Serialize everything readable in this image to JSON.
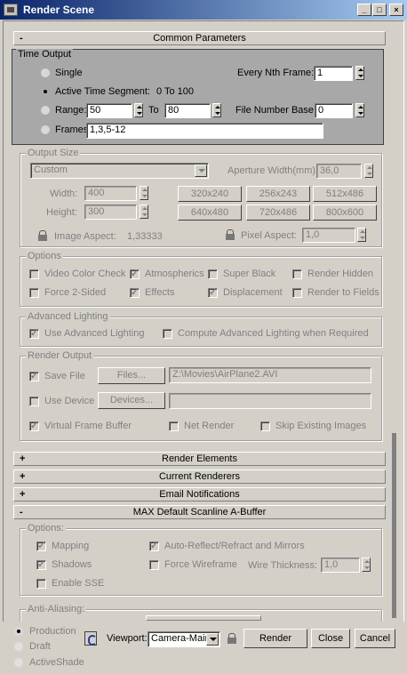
{
  "window": {
    "title": "Render Scene",
    "minimize": "_",
    "maximize": "□",
    "close": "×"
  },
  "rollouts": {
    "common": {
      "sign": "-",
      "label": "Common Parameters"
    },
    "render_elements": {
      "sign": "+",
      "label": "Render Elements"
    },
    "current_renderers": {
      "sign": "+",
      "label": "Current Renderers"
    },
    "email": {
      "sign": "+",
      "label": "Email Notifications"
    },
    "scanline": {
      "sign": "-",
      "label": "MAX Default Scanline A-Buffer"
    }
  },
  "time_output": {
    "title": "Time Output",
    "single": "Single",
    "every_nth_label": "Every Nth Frame:",
    "every_nth_value": "1",
    "active_segment": "Active Time Segment:",
    "active_range": "0 To 100",
    "range": "Range:",
    "range_from": "50",
    "to": "To",
    "range_to": "80",
    "file_number_base_label": "File Number Base:",
    "file_number_base_value": "0",
    "frames": "Frames",
    "frames_value": "1,3,5-12"
  },
  "output_size": {
    "title": "Output Size",
    "preset": "Custom",
    "aperture_label": "Aperture Width(mm):",
    "aperture_value": "36,0",
    "width_label": "Width:",
    "width_value": "400",
    "height_label": "Height:",
    "height_value": "300",
    "presets": [
      "320x240",
      "256x243",
      "512x486",
      "640x480",
      "720x486",
      "800x600"
    ],
    "image_aspect_label": "Image Aspect:",
    "image_aspect_value": "1,33333",
    "pixel_aspect_label": "Pixel Aspect:",
    "pixel_aspect_value": "1,0"
  },
  "options": {
    "title": "Options",
    "video_color_check": "Video Color Check",
    "atmospherics": "Atmospherics",
    "super_black": "Super Black",
    "render_hidden": "Render Hidden",
    "force_2sided": "Force 2-Sided",
    "effects": "Effects",
    "displacement": "Displacement",
    "render_to_fields": "Render to Fields"
  },
  "advanced_lighting": {
    "title": "Advanced Lighting",
    "use": "Use Advanced Lighting",
    "compute": "Compute Advanced Lighting when Required"
  },
  "render_output": {
    "title": "Render Output",
    "save_file": "Save File",
    "files_button": "Files...",
    "file_path": "Z:\\Movies\\AirPlane2.AVI",
    "use_device": "Use Device",
    "devices_button": "Devices...",
    "virtual_frame_buffer": "Virtual Frame Buffer",
    "net_render": "Net Render",
    "skip_existing": "Skip Existing Images"
  },
  "scanline_options": {
    "title": "Options:",
    "mapping": "Mapping",
    "auto_reflect": "Auto-Reflect/Refract and Mirrors",
    "shadows": "Shadows",
    "force_wireframe": "Force Wireframe",
    "wire_thickness_label": "Wire Thickness:",
    "wire_thickness_value": "1,0",
    "enable_sse": "Enable SSE"
  },
  "anti_aliasing": {
    "title": "Anti-Aliasing:"
  },
  "bottom": {
    "production": "Production",
    "draft": "Draft",
    "activeshade": "ActiveShade",
    "viewport_label": "Viewport:",
    "viewport_value": "Camera-Main",
    "render": "Render",
    "close": "Close",
    "cancel": "Cancel"
  }
}
